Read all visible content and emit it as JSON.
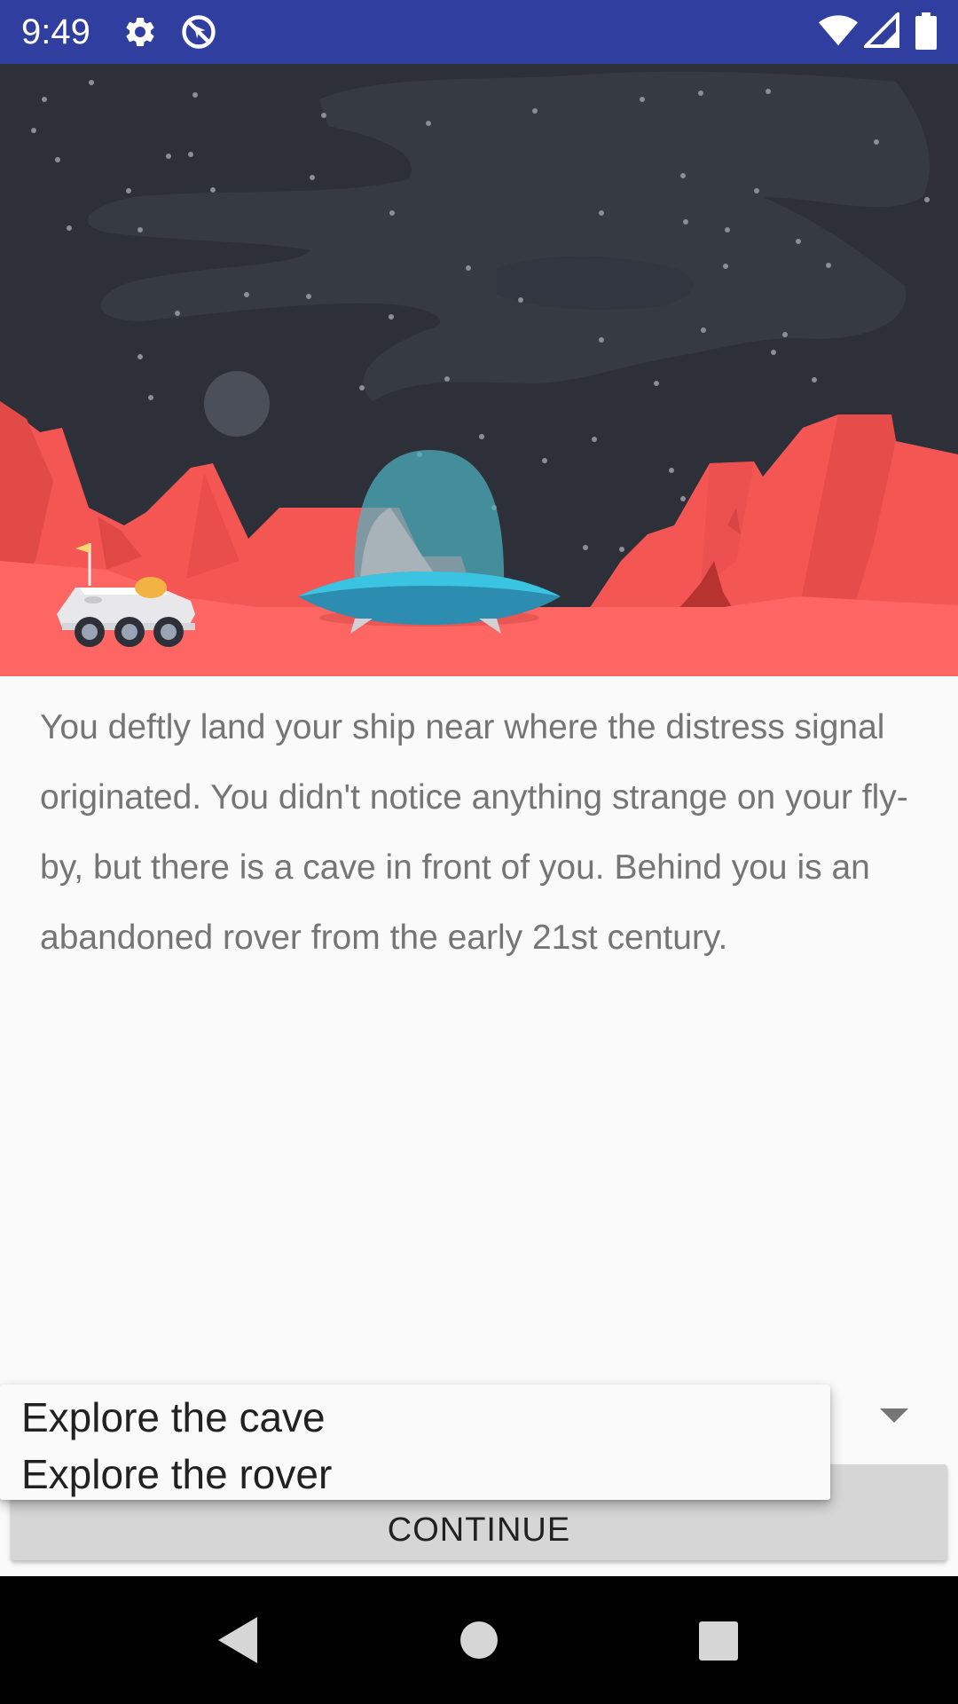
{
  "status_bar": {
    "time": "9:49",
    "icons": [
      "gear-icon",
      "no-location-icon",
      "wifi-icon",
      "cellular-signal-icon",
      "battery-icon"
    ]
  },
  "hero": {
    "illustration": "mars landscape with landed spaceship and abandoned rover",
    "colors": {
      "sky": "#2d3038",
      "ground": "#fe6663",
      "mountains": "#f45653",
      "ship": "#3bb3d2"
    }
  },
  "story": {
    "text": "You deftly land your ship near where the distress signal originated. You didn't notice anything strange on your fly-by, but there is a cave in front of you. Behind you is an abandoned rover from the early 21st century."
  },
  "choice": {
    "options": [
      "Explore the cave",
      "Explore the rover"
    ]
  },
  "continue_button": {
    "label": "CONTINUE"
  },
  "nav_bar": {
    "icons": [
      "back-icon",
      "home-icon",
      "recents-icon"
    ]
  }
}
